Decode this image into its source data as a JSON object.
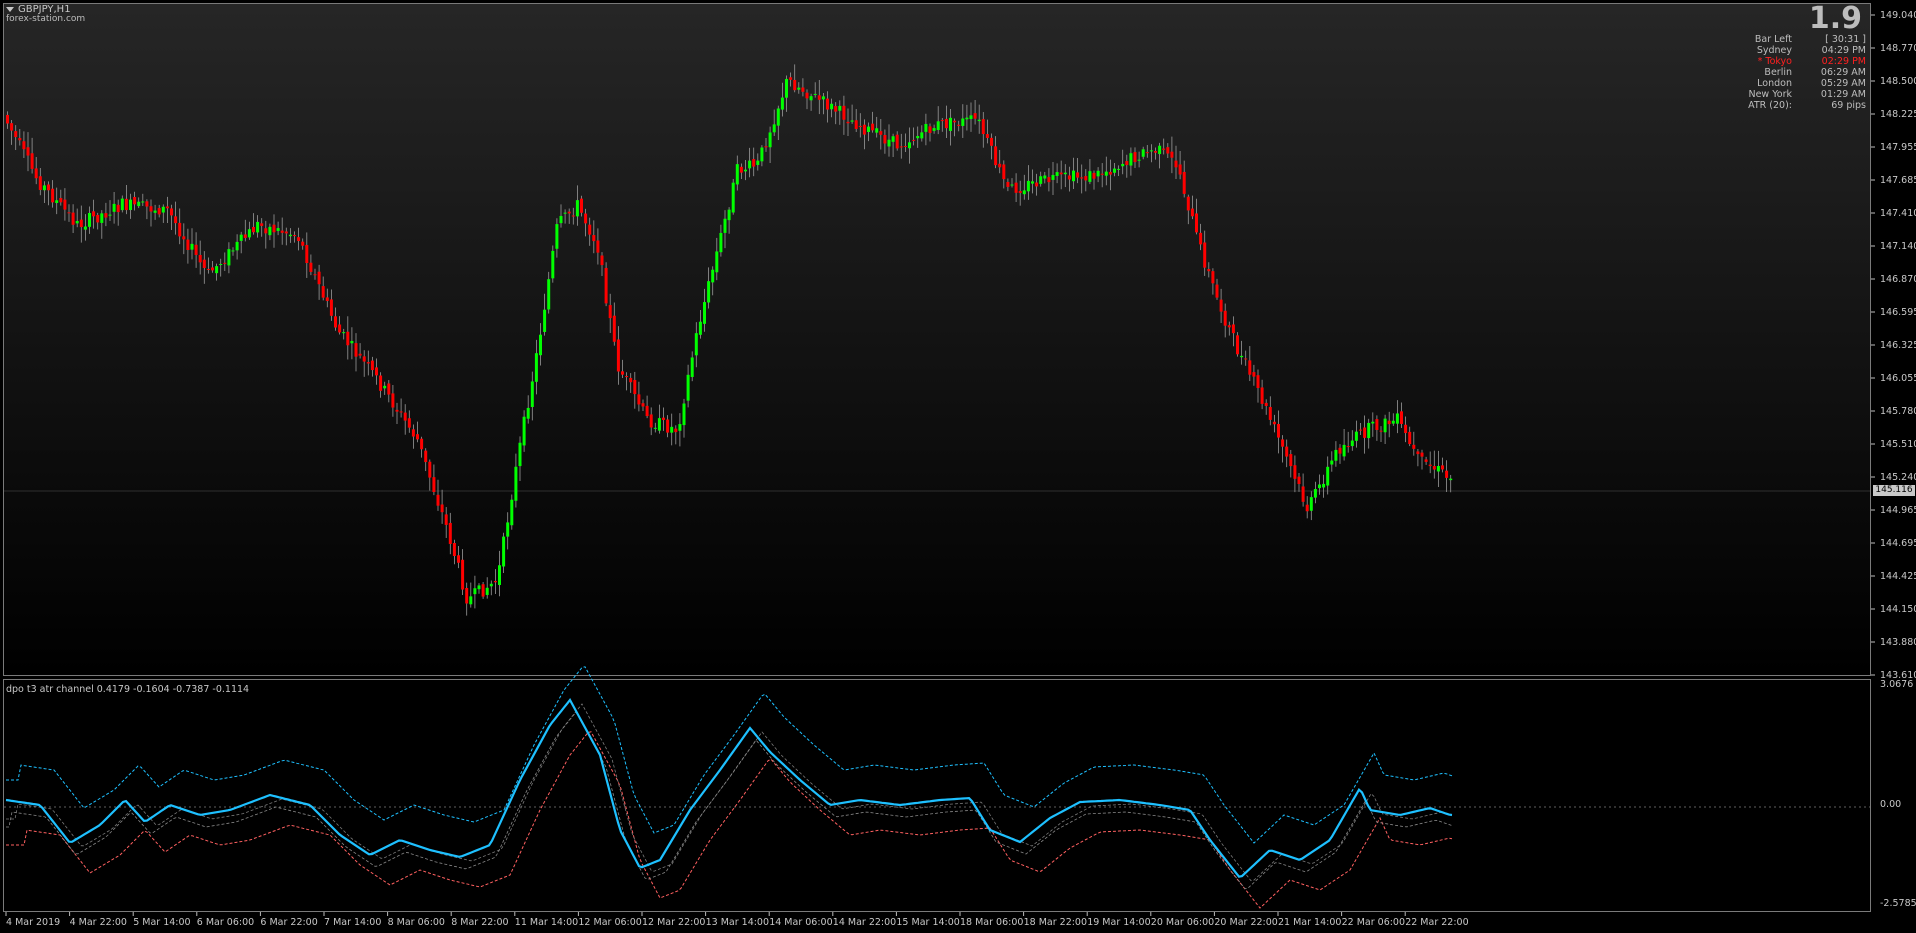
{
  "chart": {
    "symbol": "GBPJPY,H1",
    "watermark": "forex-station.com",
    "current_price": "145.116",
    "price_axis": [
      "149.040",
      "148.770",
      "148.500",
      "148.225",
      "147.955",
      "147.685",
      "147.410",
      "147.140",
      "146.870",
      "146.595",
      "146.325",
      "146.055",
      "145.780",
      "145.510",
      "145.240",
      "144.965",
      "144.695",
      "144.425",
      "144.150",
      "143.880",
      "143.610"
    ],
    "time_axis": [
      "4 Mar 2019",
      "4 Mar 22:00",
      "5 Mar 14:00",
      "6 Mar 06:00",
      "6 Mar 22:00",
      "7 Mar 14:00",
      "8 Mar 06:00",
      "8 Mar 22:00",
      "11 Mar 14:00",
      "12 Mar 06:00",
      "12 Mar 22:00",
      "13 Mar 14:00",
      "14 Mar 06:00",
      "14 Mar 22:00",
      "15 Mar 14:00",
      "18 Mar 06:00",
      "18 Mar 22:00",
      "19 Mar 14:00",
      "20 Mar 06:00",
      "20 Mar 22:00",
      "21 Mar 14:00",
      "22 Mar 06:00",
      "22 Mar 22:00"
    ],
    "colors": {
      "bull": "#00ff00",
      "bear": "#ff0000",
      "line": "#1ec0ff",
      "dash": "#1ec0ff",
      "lower": "#ff6060",
      "grid": "#808080"
    }
  },
  "info": {
    "big_value": "1.9",
    "rows": [
      {
        "label": "Bar Left",
        "value": "[ 30:31 ]",
        "highlight": false
      },
      {
        "label": "Sydney",
        "value": "04:29 PM",
        "highlight": false
      },
      {
        "label": "* Tokyo",
        "value": "02:29 PM",
        "highlight": true
      },
      {
        "label": "Berlin",
        "value": "06:29 AM",
        "highlight": false
      },
      {
        "label": "London",
        "value": "05:29 AM",
        "highlight": false
      },
      {
        "label": "New York",
        "value": "01:29 AM",
        "highlight": false
      },
      {
        "label": "ATR (20):",
        "value": "69 pips",
        "highlight": false
      }
    ]
  },
  "indicator": {
    "label": "dpo t3 atr channel 0.4179 -0.1604 -0.7387 -0.1114",
    "axis": [
      "3.0676",
      "0.00",
      "-2.5785"
    ]
  }
}
